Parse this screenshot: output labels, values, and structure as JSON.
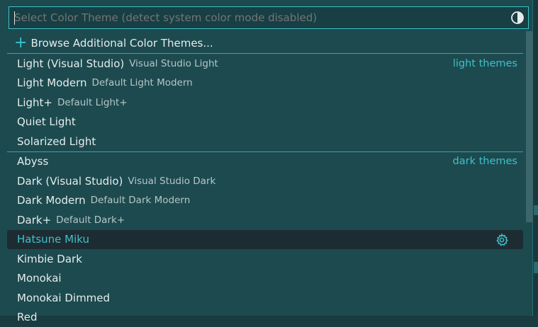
{
  "quickpick": {
    "placeholder": "Select Color Theme (detect system color mode disabled)",
    "toggle_icon": "contrast-icon",
    "browse_label": "Browse Additional Color Themes...",
    "light_group_label": "light themes",
    "dark_group_label": "dark themes",
    "light_items": [
      {
        "label": "Light (Visual Studio)",
        "description": "Visual Studio Light"
      },
      {
        "label": "Light Modern",
        "description": "Default Light Modern"
      },
      {
        "label": "Light+",
        "description": "Default Light+"
      },
      {
        "label": "Quiet Light",
        "description": ""
      },
      {
        "label": "Solarized Light",
        "description": ""
      }
    ],
    "dark_items": [
      {
        "label": "Abyss",
        "description": ""
      },
      {
        "label": "Dark (Visual Studio)",
        "description": "Visual Studio Dark"
      },
      {
        "label": "Dark Modern",
        "description": "Default Dark Modern"
      },
      {
        "label": "Dark+",
        "description": "Default Dark+"
      },
      {
        "label": "Hatsune Miku",
        "description": ""
      },
      {
        "label": "Kimbie Dark",
        "description": ""
      },
      {
        "label": "Monokai",
        "description": ""
      },
      {
        "label": "Monokai Dimmed",
        "description": ""
      },
      {
        "label": "Red",
        "description": ""
      }
    ],
    "selected_item_icon": "gear-icon"
  },
  "colors": {
    "accent": "#3fc1c9",
    "background": "#1c4a4f",
    "selected_row": "#1d2c32"
  }
}
